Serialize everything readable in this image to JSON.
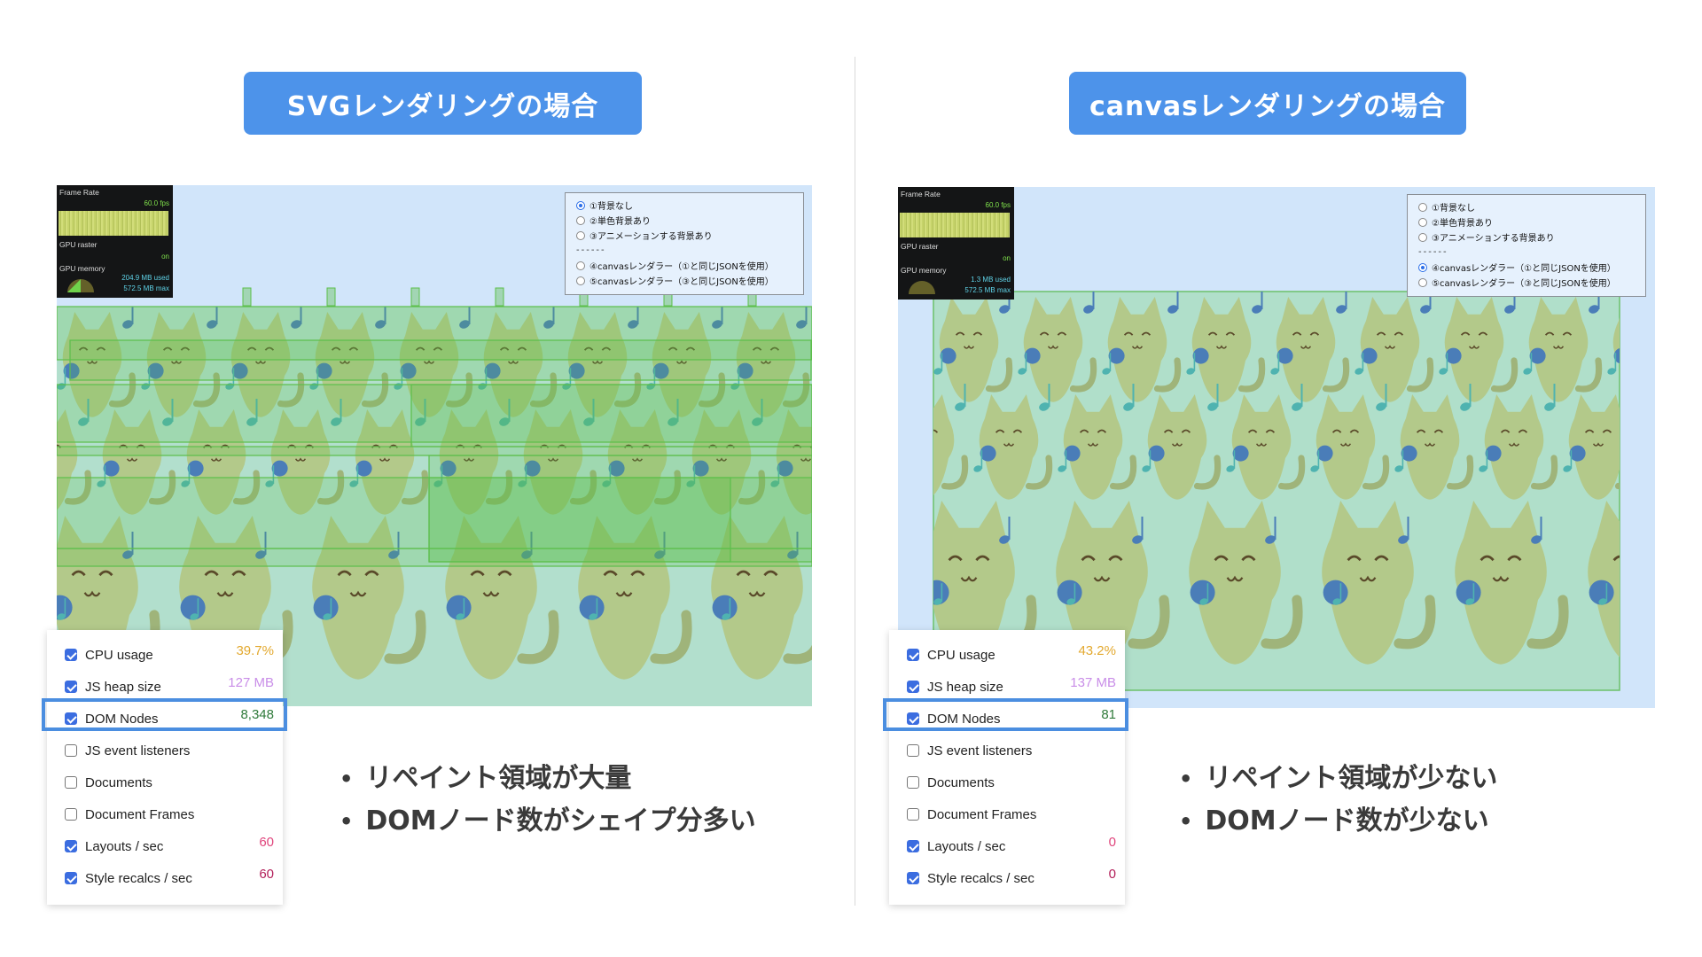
{
  "left": {
    "title": "SVGレンダリングの場合",
    "hud": {
      "frame_rate_label": "Frame Rate",
      "frame_rate_value": "60.0 fps",
      "gpu_raster_label": "GPU raster",
      "gpu_raster_value": "on",
      "gpu_memory_label": "GPU memory",
      "gpu_memory_used": "204.9 MB used",
      "gpu_memory_max": "572.5 MB max"
    },
    "radio_options": [
      {
        "label": "①背景なし",
        "selected": true
      },
      {
        "label": "②単色背景あり",
        "selected": false
      },
      {
        "label": "③アニメーションする背景あり",
        "selected": false
      },
      {
        "label": "④canvasレンダラー（①と同じJSONを使用）",
        "selected": false
      },
      {
        "label": "⑤canvasレンダラー（③と同じJSONを使用）",
        "selected": false
      }
    ],
    "radio_separator": "------",
    "metrics": [
      {
        "label": "CPU usage",
        "checked": true,
        "value": "39.7%",
        "color": "#e3a92f"
      },
      {
        "label": "JS heap size",
        "checked": true,
        "value": "127 MB",
        "color": "#c98ee8"
      },
      {
        "label": "DOM Nodes",
        "checked": true,
        "value": "8,348",
        "color": "#2f7a3a"
      },
      {
        "label": "JS event listeners",
        "checked": false,
        "value": "",
        "color": "#333333"
      },
      {
        "label": "Documents",
        "checked": false,
        "value": "",
        "color": "#333333"
      },
      {
        "label": "Document Frames",
        "checked": false,
        "value": "",
        "color": "#333333"
      },
      {
        "label": "Layouts / sec",
        "checked": true,
        "value": "60",
        "color": "#e0457c"
      },
      {
        "label": "Style recalcs / sec",
        "checked": true,
        "value": "60",
        "color": "#b3205a"
      }
    ],
    "bullets": [
      "リペイント領域が大量",
      "DOMノード数がシェイプ分多い"
    ]
  },
  "right": {
    "title": "canvasレンダリングの場合",
    "hud": {
      "frame_rate_label": "Frame Rate",
      "frame_rate_value": "60.0 fps",
      "gpu_raster_label": "GPU raster",
      "gpu_raster_value": "on",
      "gpu_memory_label": "GPU memory",
      "gpu_memory_used": "1.3 MB used",
      "gpu_memory_max": "572.5 MB max"
    },
    "radio_options": [
      {
        "label": "①背景なし",
        "selected": false
      },
      {
        "label": "②単色背景あり",
        "selected": false
      },
      {
        "label": "③アニメーションする背景あり",
        "selected": false
      },
      {
        "label": "④canvasレンダラー（①と同じJSONを使用）",
        "selected": true
      },
      {
        "label": "⑤canvasレンダラー（③と同じJSONを使用）",
        "selected": false
      }
    ],
    "radio_separator": "------",
    "metrics": [
      {
        "label": "CPU usage",
        "checked": true,
        "value": "43.2%",
        "color": "#e3a92f"
      },
      {
        "label": "JS heap size",
        "checked": true,
        "value": "137 MB",
        "color": "#c98ee8"
      },
      {
        "label": "DOM Nodes",
        "checked": true,
        "value": "81",
        "color": "#2f7a3a"
      },
      {
        "label": "JS event listeners",
        "checked": false,
        "value": "",
        "color": "#333333"
      },
      {
        "label": "Documents",
        "checked": false,
        "value": "",
        "color": "#333333"
      },
      {
        "label": "Document Frames",
        "checked": false,
        "value": "",
        "color": "#333333"
      },
      {
        "label": "Layouts / sec",
        "checked": true,
        "value": "0",
        "color": "#e0457c"
      },
      {
        "label": "Style recalcs / sec",
        "checked": true,
        "value": "0",
        "color": "#b3205a"
      }
    ],
    "bullets": [
      "リペイント領域が少ない",
      "DOMノード数が少ない"
    ]
  },
  "colors": {
    "title_bg": "#4d93ea",
    "highlight": "#4b8ee0",
    "scene_bg": "#d1e5fa",
    "repaint_green": "#5cbf4a",
    "cat": "#b3c98a",
    "note_blue": "#4a7db8",
    "note_teal": "#4fb3b0"
  }
}
